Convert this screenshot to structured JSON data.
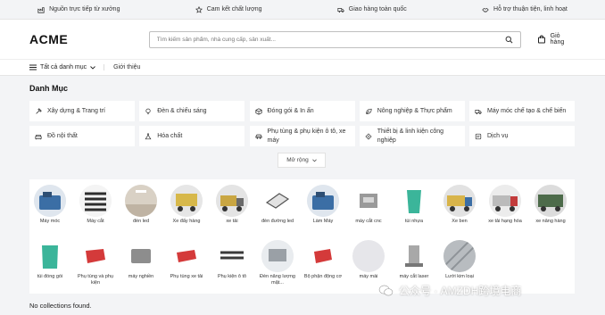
{
  "topbar": [
    {
      "label": "Nguồn trực tiếp từ xưởng",
      "icon": "factory-icon"
    },
    {
      "label": "Cam kết chất lượng",
      "icon": "star-icon"
    },
    {
      "label": "Giao hàng toàn quốc",
      "icon": "truck-icon"
    },
    {
      "label": "Hỗ trợ thuận tiện, linh hoạt",
      "icon": "handshake-icon"
    }
  ],
  "header": {
    "logo": "ACME",
    "search_placeholder": "Tìm kiếm sản phẩm, nhà cung cấp, sản xuất...",
    "cart_label": "Giỏ hàng"
  },
  "nav": {
    "all_categories": "Tất cả danh mục",
    "intro": "Giới thiệu"
  },
  "categories": {
    "title": "Danh Mục",
    "items": [
      {
        "label": "Xây dựng & Trang trí",
        "icon": "hammer-icon"
      },
      {
        "label": "Đèn & chiếu sáng",
        "icon": "bulb-icon"
      },
      {
        "label": "Đóng gói & In ấn",
        "icon": "box-icon"
      },
      {
        "label": "Nông nghiệp & Thực phẩm",
        "icon": "leaf-icon"
      },
      {
        "label": "Máy móc chế tạo & chế biến",
        "icon": "truck-icon"
      },
      {
        "label": "Đồ nội thất",
        "icon": "sofa-icon"
      },
      {
        "label": "Hóa chất",
        "icon": "flask-icon"
      },
      {
        "label": "Phụ tùng & phụ kiện ô tô, xe máy",
        "icon": "car-icon"
      },
      {
        "label": "Thiết bị & linh kiện công nghiệp",
        "icon": "gear-icon"
      },
      {
        "label": "Dịch vụ",
        "icon": "service-icon"
      }
    ],
    "more_label": "Mở rộng"
  },
  "products": {
    "row1": [
      {
        "label": "Máy móc",
        "color": "#3b6ea5"
      },
      {
        "label": "Máy cắt",
        "color": "#2d2d2d"
      },
      {
        "label": "đèn led",
        "color": "#cfc5b8"
      },
      {
        "label": "Xe đẩy hàng",
        "color": "#d7b84a"
      },
      {
        "label": "xe tải",
        "color": "#c9a642"
      },
      {
        "label": "đèn đường led",
        "color": "#7a7a7a"
      },
      {
        "label": "Làm Máy",
        "color": "#3b6ea5"
      },
      {
        "label": "máy cắt cnc",
        "color": "#9a9a9a"
      },
      {
        "label": "túi nhựa",
        "color": "#3bb59a"
      },
      {
        "label": "Xe ben",
        "color": "#d8b44a"
      },
      {
        "label": "xe tải hạng hóa",
        "color": "#c23b3b"
      },
      {
        "label": "xe nâng hàng",
        "color": "#4d6b4a"
      }
    ],
    "row2": [
      {
        "label": "túi đóng gói",
        "color": "#3bb59a"
      },
      {
        "label": "Phụ tùng và phụ kiện",
        "color": "#d43a3a"
      },
      {
        "label": "máy nghiền",
        "color": "#8d8d8d"
      },
      {
        "label": "Phụ tùng xe tải",
        "color": "#d43a3a"
      },
      {
        "label": "Phụ kiện ô tô",
        "color": "#3a3a3a"
      },
      {
        "label": "Đèn năng lượng mặt...",
        "color": "#9aa0a6"
      },
      {
        "label": "Bộ phận động cơ",
        "color": "#d43a3a"
      },
      {
        "label": "máy mài",
        "color": "#e6e6ea"
      },
      {
        "label": "máy cắt laser",
        "color": "#a8a8a8"
      },
      {
        "label": "Lưới kim loại",
        "color": "#9ea3a8"
      }
    ]
  },
  "empty_message": "No collections found.",
  "watermark": "公众号 · AMZDH跨境电商"
}
